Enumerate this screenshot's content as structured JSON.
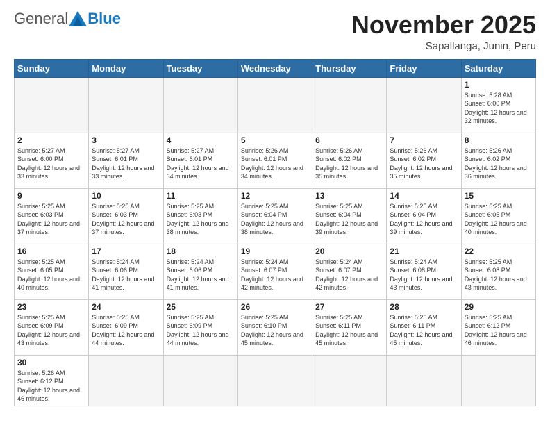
{
  "header": {
    "logo_general": "General",
    "logo_blue": "Blue",
    "month_title": "November 2025",
    "location": "Sapallanga, Junin, Peru"
  },
  "weekdays": [
    "Sunday",
    "Monday",
    "Tuesday",
    "Wednesday",
    "Thursday",
    "Friday",
    "Saturday"
  ],
  "weeks": [
    [
      {
        "day": "",
        "empty": true
      },
      {
        "day": "",
        "empty": true
      },
      {
        "day": "",
        "empty": true
      },
      {
        "day": "",
        "empty": true
      },
      {
        "day": "",
        "empty": true
      },
      {
        "day": "",
        "empty": true
      },
      {
        "day": "1",
        "sunrise": "5:28 AM",
        "sunset": "6:00 PM",
        "daylight": "12 hours and 32 minutes."
      }
    ],
    [
      {
        "day": "2",
        "sunrise": "5:27 AM",
        "sunset": "6:00 PM",
        "daylight": "12 hours and 33 minutes."
      },
      {
        "day": "3",
        "sunrise": "5:27 AM",
        "sunset": "6:01 PM",
        "daylight": "12 hours and 33 minutes."
      },
      {
        "day": "4",
        "sunrise": "5:27 AM",
        "sunset": "6:01 PM",
        "daylight": "12 hours and 34 minutes."
      },
      {
        "day": "5",
        "sunrise": "5:26 AM",
        "sunset": "6:01 PM",
        "daylight": "12 hours and 34 minutes."
      },
      {
        "day": "6",
        "sunrise": "5:26 AM",
        "sunset": "6:02 PM",
        "daylight": "12 hours and 35 minutes."
      },
      {
        "day": "7",
        "sunrise": "5:26 AM",
        "sunset": "6:02 PM",
        "daylight": "12 hours and 35 minutes."
      },
      {
        "day": "8",
        "sunrise": "5:26 AM",
        "sunset": "6:02 PM",
        "daylight": "12 hours and 36 minutes."
      }
    ],
    [
      {
        "day": "9",
        "sunrise": "5:25 AM",
        "sunset": "6:03 PM",
        "daylight": "12 hours and 37 minutes."
      },
      {
        "day": "10",
        "sunrise": "5:25 AM",
        "sunset": "6:03 PM",
        "daylight": "12 hours and 37 minutes."
      },
      {
        "day": "11",
        "sunrise": "5:25 AM",
        "sunset": "6:03 PM",
        "daylight": "12 hours and 38 minutes."
      },
      {
        "day": "12",
        "sunrise": "5:25 AM",
        "sunset": "6:04 PM",
        "daylight": "12 hours and 38 minutes."
      },
      {
        "day": "13",
        "sunrise": "5:25 AM",
        "sunset": "6:04 PM",
        "daylight": "12 hours and 39 minutes."
      },
      {
        "day": "14",
        "sunrise": "5:25 AM",
        "sunset": "6:04 PM",
        "daylight": "12 hours and 39 minutes."
      },
      {
        "day": "15",
        "sunrise": "5:25 AM",
        "sunset": "6:05 PM",
        "daylight": "12 hours and 40 minutes."
      }
    ],
    [
      {
        "day": "16",
        "sunrise": "5:25 AM",
        "sunset": "6:05 PM",
        "daylight": "12 hours and 40 minutes."
      },
      {
        "day": "17",
        "sunrise": "5:24 AM",
        "sunset": "6:06 PM",
        "daylight": "12 hours and 41 minutes."
      },
      {
        "day": "18",
        "sunrise": "5:24 AM",
        "sunset": "6:06 PM",
        "daylight": "12 hours and 41 minutes."
      },
      {
        "day": "19",
        "sunrise": "5:24 AM",
        "sunset": "6:07 PM",
        "daylight": "12 hours and 42 minutes."
      },
      {
        "day": "20",
        "sunrise": "5:24 AM",
        "sunset": "6:07 PM",
        "daylight": "12 hours and 42 minutes."
      },
      {
        "day": "21",
        "sunrise": "5:24 AM",
        "sunset": "6:08 PM",
        "daylight": "12 hours and 43 minutes."
      },
      {
        "day": "22",
        "sunrise": "5:25 AM",
        "sunset": "6:08 PM",
        "daylight": "12 hours and 43 minutes."
      }
    ],
    [
      {
        "day": "23",
        "sunrise": "5:25 AM",
        "sunset": "6:09 PM",
        "daylight": "12 hours and 43 minutes."
      },
      {
        "day": "24",
        "sunrise": "5:25 AM",
        "sunset": "6:09 PM",
        "daylight": "12 hours and 44 minutes."
      },
      {
        "day": "25",
        "sunrise": "5:25 AM",
        "sunset": "6:09 PM",
        "daylight": "12 hours and 44 minutes."
      },
      {
        "day": "26",
        "sunrise": "5:25 AM",
        "sunset": "6:10 PM",
        "daylight": "12 hours and 45 minutes."
      },
      {
        "day": "27",
        "sunrise": "5:25 AM",
        "sunset": "6:11 PM",
        "daylight": "12 hours and 45 minutes."
      },
      {
        "day": "28",
        "sunrise": "5:25 AM",
        "sunset": "6:11 PM",
        "daylight": "12 hours and 45 minutes."
      },
      {
        "day": "29",
        "sunrise": "5:25 AM",
        "sunset": "6:12 PM",
        "daylight": "12 hours and 46 minutes."
      }
    ],
    [
      {
        "day": "30",
        "sunrise": "5:26 AM",
        "sunset": "6:12 PM",
        "daylight": "12 hours and 46 minutes."
      },
      {
        "day": "",
        "empty": true
      },
      {
        "day": "",
        "empty": true
      },
      {
        "day": "",
        "empty": true
      },
      {
        "day": "",
        "empty": true
      },
      {
        "day": "",
        "empty": true
      },
      {
        "day": "",
        "empty": true
      }
    ]
  ]
}
